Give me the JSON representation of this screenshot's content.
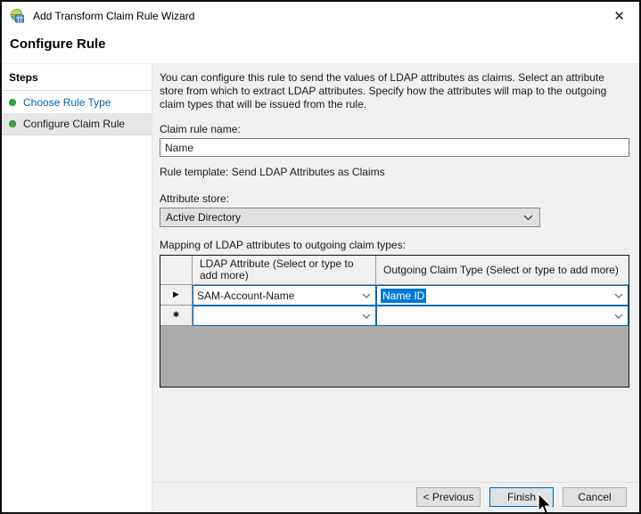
{
  "window": {
    "title": "Add Transform Claim Rule Wizard",
    "close_glyph": "✕"
  },
  "header": {
    "title": "Configure Rule"
  },
  "sidebar": {
    "title": "Steps",
    "items": [
      {
        "label": "Choose Rule Type",
        "state": "link"
      },
      {
        "label": "Configure Claim Rule",
        "state": "active"
      }
    ]
  },
  "content": {
    "description": "You can configure this rule to send the values of LDAP attributes as claims. Select an attribute store from which to extract LDAP attributes. Specify how the attributes will map to the outgoing claim types that will be issued from the rule.",
    "claim_rule_name": {
      "label": "Claim rule name:",
      "value": "Name"
    },
    "rule_template": "Rule template: Send LDAP Attributes as Claims",
    "attribute_store": {
      "label": "Attribute store:",
      "value": "Active Directory"
    },
    "mapping_label": "Mapping of LDAP attributes to outgoing claim types:",
    "table": {
      "columns": [
        "LDAP Attribute (Select or type to add more)",
        "Outgoing Claim Type (Select or type to add more)"
      ],
      "rows": [
        {
          "marker": "▶",
          "ldap_attribute": "SAM-Account-Name",
          "outgoing_claim_type": "Name ID",
          "outgoing_selected": true
        },
        {
          "marker": "✱",
          "ldap_attribute": "",
          "outgoing_claim_type": ""
        }
      ]
    }
  },
  "footer": {
    "buttons": [
      {
        "label": "< Previous",
        "focused": false
      },
      {
        "label": "Finish",
        "focused": true
      },
      {
        "label": "Cancel",
        "focused": false
      }
    ]
  },
  "colors": {
    "selection_blue": "#0078d7",
    "combo_focus_border": "#0067b8",
    "grid_background": "#ababab",
    "step_dot_green": "#38a438",
    "link_blue": "#0063b1",
    "content_background": "#f0f0f0"
  }
}
